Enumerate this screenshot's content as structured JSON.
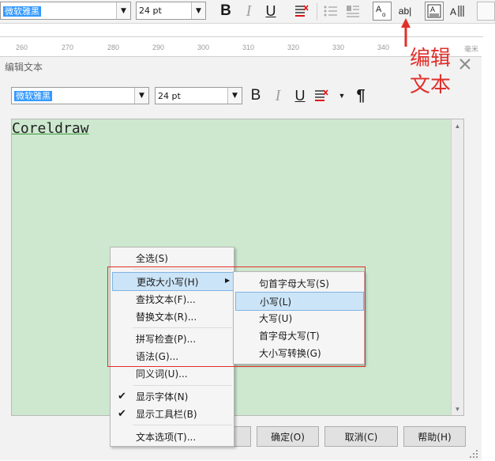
{
  "top_toolbar": {
    "font_name": "微软雅黑",
    "font_size": "24 pt"
  },
  "ruler": {
    "ticks": [
      "260",
      "270",
      "280",
      "290",
      "300",
      "310",
      "320",
      "330",
      "340"
    ],
    "unit": "毫米"
  },
  "annotation": {
    "line1": "编辑",
    "line2": "文本"
  },
  "dialog": {
    "title": "编辑文本",
    "font_name": "微软雅黑",
    "font_size": "24 pt",
    "text": "Coreldraw",
    "buttons": {
      "ok": "确定(O)",
      "cancel": "取消(C)",
      "help": "帮助(H)"
    }
  },
  "context_menu": {
    "items": [
      {
        "label": "全选(S)"
      },
      {
        "label": "更改大小写(H)"
      },
      {
        "label": "查找文本(F)..."
      },
      {
        "label": "替换文本(R)..."
      },
      {
        "label": "拼写检查(P)..."
      },
      {
        "label": "语法(G)..."
      },
      {
        "label": "同义词(U)..."
      },
      {
        "label": "显示字体(N)",
        "checked": true
      },
      {
        "label": "显示工具栏(B)",
        "checked": true
      },
      {
        "label": "文本选项(T)..."
      }
    ]
  },
  "submenu": {
    "items": [
      {
        "label": "句首字母大写(S)"
      },
      {
        "label": "小写(L)"
      },
      {
        "label": "大写(U)"
      },
      {
        "label": "首字母大写(T)"
      },
      {
        "label": "大小写转换(G)"
      }
    ]
  },
  "colors": {
    "edit_background": "#cde8cf",
    "highlight_border": "#e0302b",
    "selection": "#3399ff"
  }
}
